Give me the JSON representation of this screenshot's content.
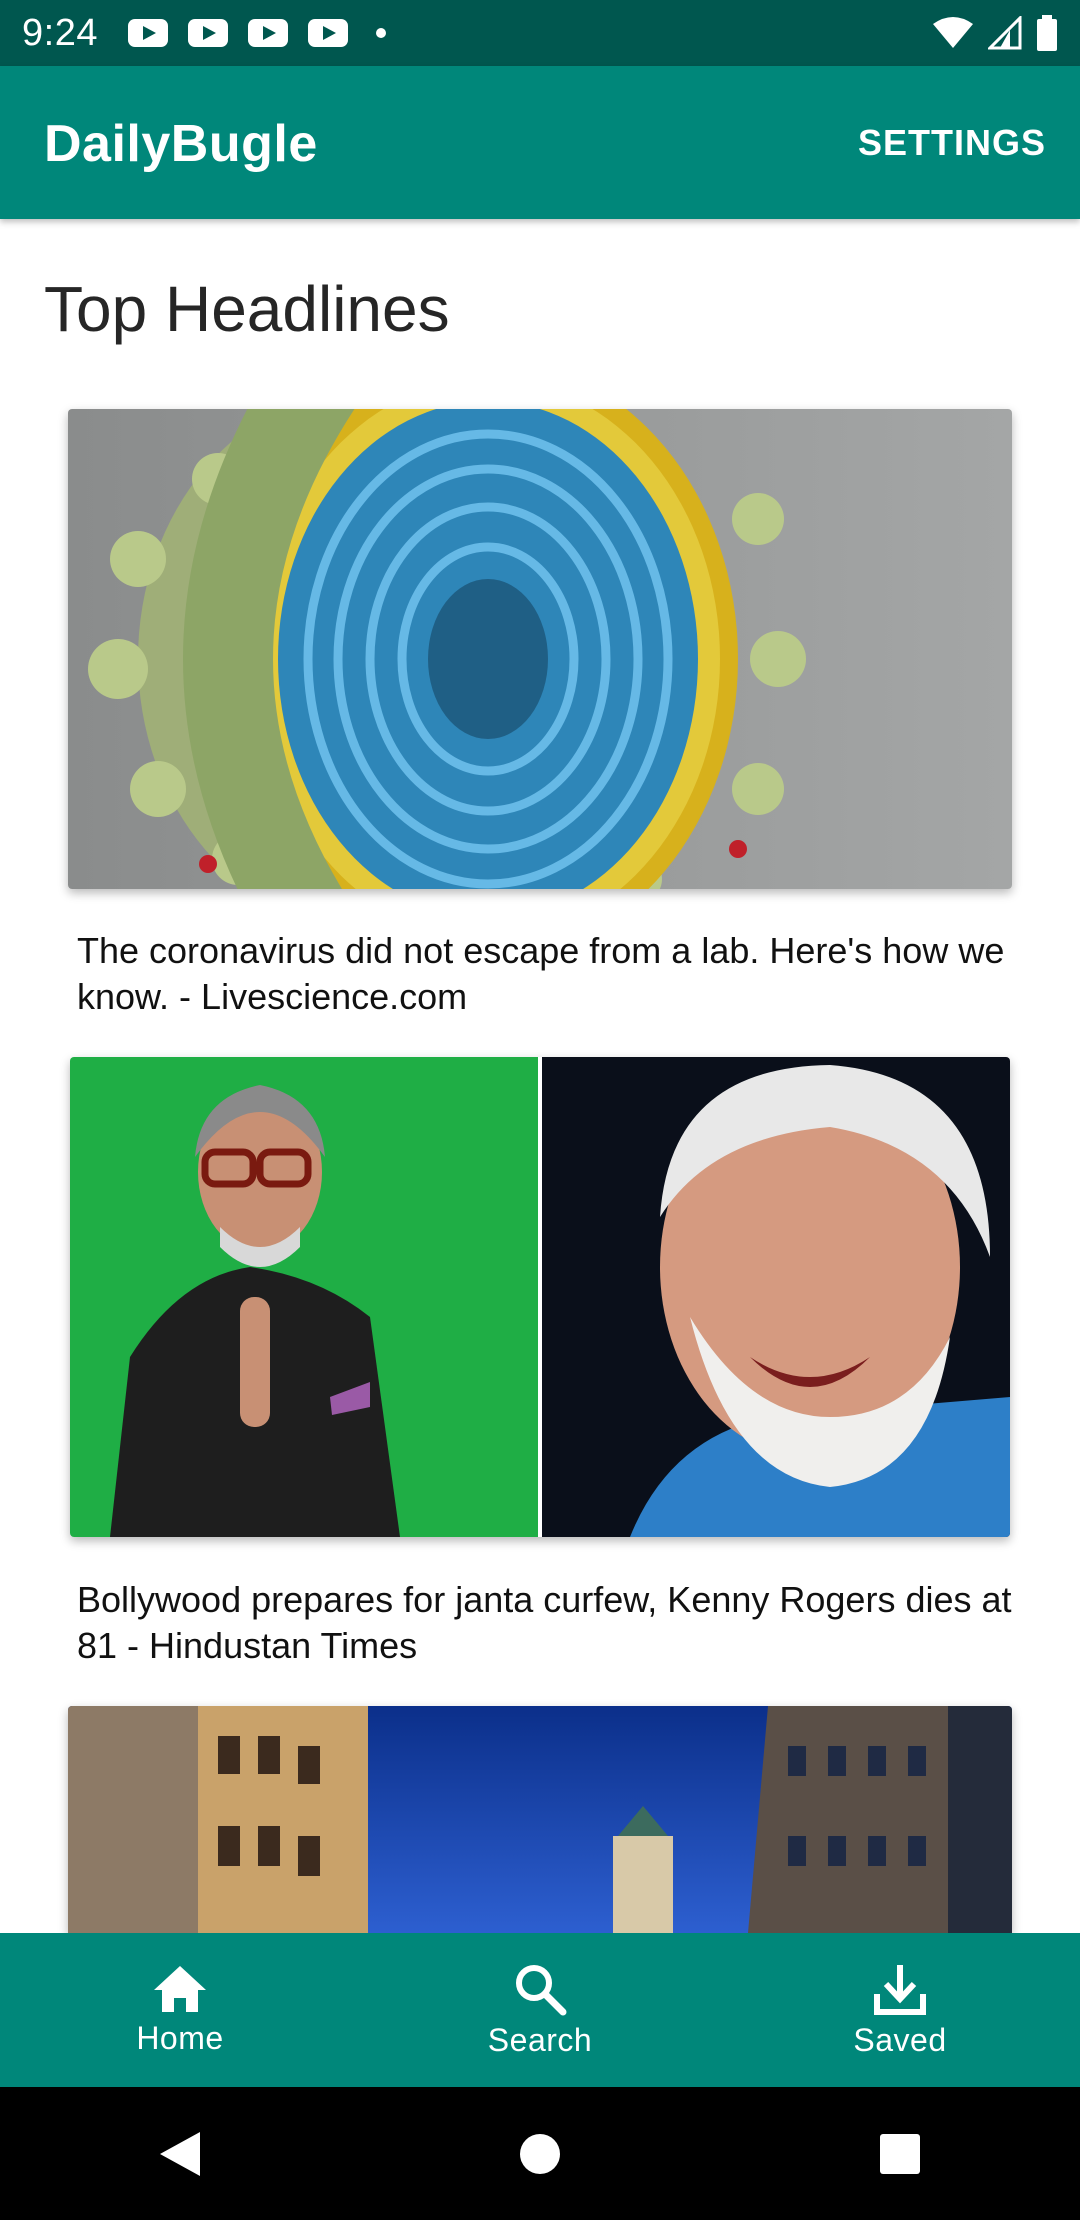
{
  "status_bar": {
    "time": "9:24",
    "notification_icons": [
      "youtube-icon",
      "youtube-icon",
      "youtube-icon",
      "youtube-icon",
      "dot-icon"
    ],
    "system_icons": [
      "wifi-icon",
      "signal-icon",
      "battery-icon"
    ]
  },
  "app_bar": {
    "title": "DailyBugle",
    "settings_label": "SETTINGS"
  },
  "main": {
    "heading": "Top Headlines",
    "articles": [
      {
        "title": "The coronavirus did not escape from a lab. Here's how we know. - Livescience.com",
        "image_icon": "virus-image"
      },
      {
        "title": "Bollywood prepares for janta curfew, Kenny Rogers dies at 81 - Hindustan Times",
        "image_icon": "portraits-image"
      },
      {
        "title": "",
        "image_icon": "city-building-image"
      }
    ]
  },
  "bottom_nav": {
    "items": [
      {
        "label": "Home",
        "icon": "home-icon"
      },
      {
        "label": "Search",
        "icon": "search-icon"
      },
      {
        "label": "Saved",
        "icon": "download-icon"
      }
    ]
  },
  "colors": {
    "primary": "#00877a",
    "primary_dark": "#00574f",
    "on_primary": "#ffffff"
  }
}
